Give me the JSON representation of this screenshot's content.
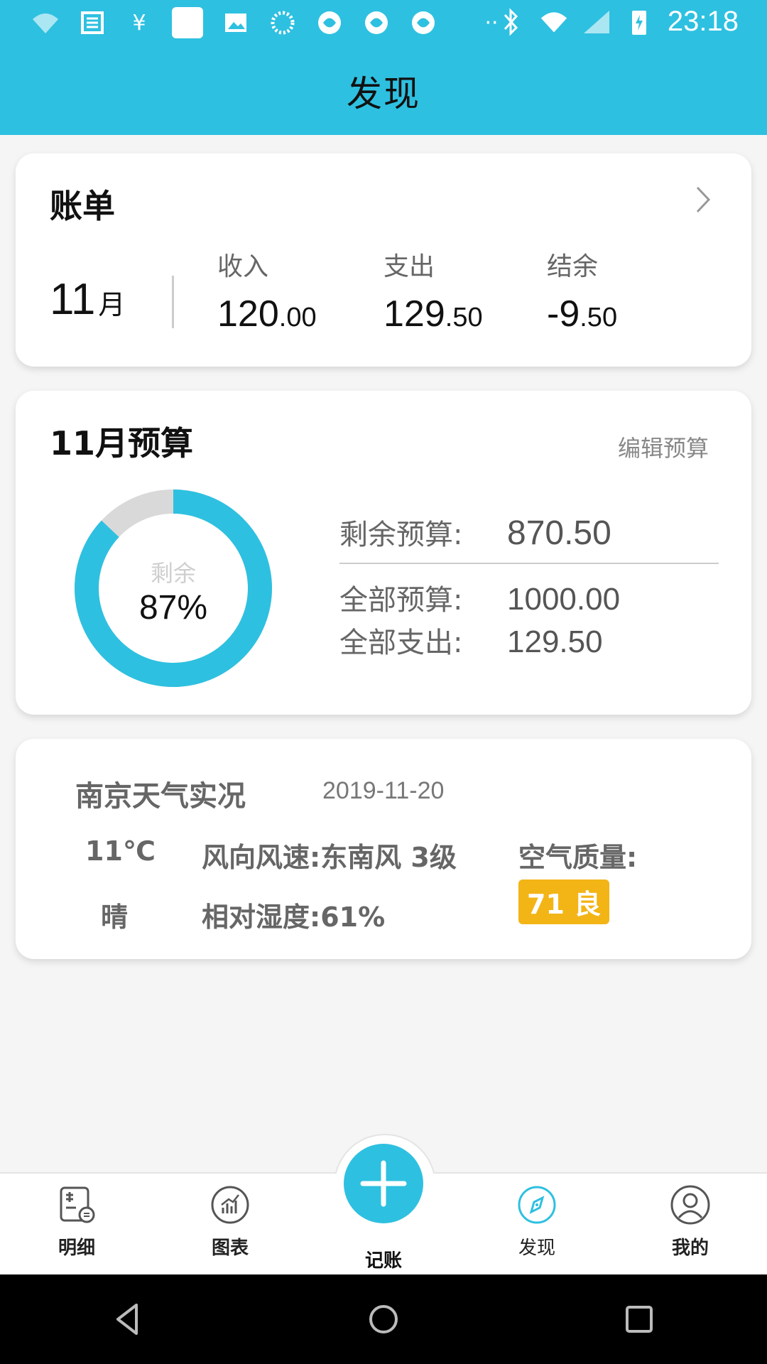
{
  "status_bar": {
    "time": "23:18",
    "left_icons": [
      "wifi-question-icon",
      "news-icon",
      "yen-icon",
      "white-square-icon",
      "image-icon",
      "loading-icon",
      "sync-icon",
      "sync-icon",
      "sync-icon",
      "dots-icon"
    ],
    "right_icons": [
      "bluetooth-icon",
      "wifi-off-icon",
      "signal-icon",
      "battery-charging-icon"
    ]
  },
  "app_bar": {
    "title": "发现"
  },
  "bill": {
    "title": "账单",
    "month": "11",
    "month_unit": "月",
    "income": {
      "label": "收入",
      "int": "120",
      "dec": ".00"
    },
    "expense": {
      "label": "支出",
      "int": "129",
      "dec": ".50"
    },
    "balance": {
      "label": "结余",
      "int": "-9",
      "dec": ".50"
    }
  },
  "budget": {
    "title": "11月预算",
    "edit_label": "编辑预算",
    "donut_label": "剩余",
    "remaining_percent_text": "87%",
    "remaining_fraction": 0.87,
    "remaining_label": "剩余预算:",
    "remaining_value": "870.50",
    "total_label": "全部预算:",
    "total_value": "1000.00",
    "spent_label": "全部支出:",
    "spent_value": "129.50",
    "colors": {
      "remaining": "#2ec0e0",
      "spent": "#d9d9d9"
    }
  },
  "weather": {
    "title": "南京天气实况",
    "date": "2019-11-20",
    "temperature": "11℃",
    "condition": "晴",
    "wind": "风向风速:东南风 3级",
    "humidity": "相对湿度:61%",
    "aqi_label": "空气质量:",
    "aqi_value": "71 良",
    "aqi_color": "#f3b416"
  },
  "bottom_nav": {
    "items": [
      {
        "label": "明细",
        "icon": "detail-list-icon"
      },
      {
        "label": "图表",
        "icon": "chart-icon"
      },
      {
        "label": "记账",
        "icon": "plus-icon"
      },
      {
        "label": "发现",
        "icon": "compass-icon",
        "active": true
      },
      {
        "label": "我的",
        "icon": "profile-icon"
      }
    ]
  },
  "theme": {
    "primary": "#2ec0e0",
    "background": "#f5f5f5"
  }
}
